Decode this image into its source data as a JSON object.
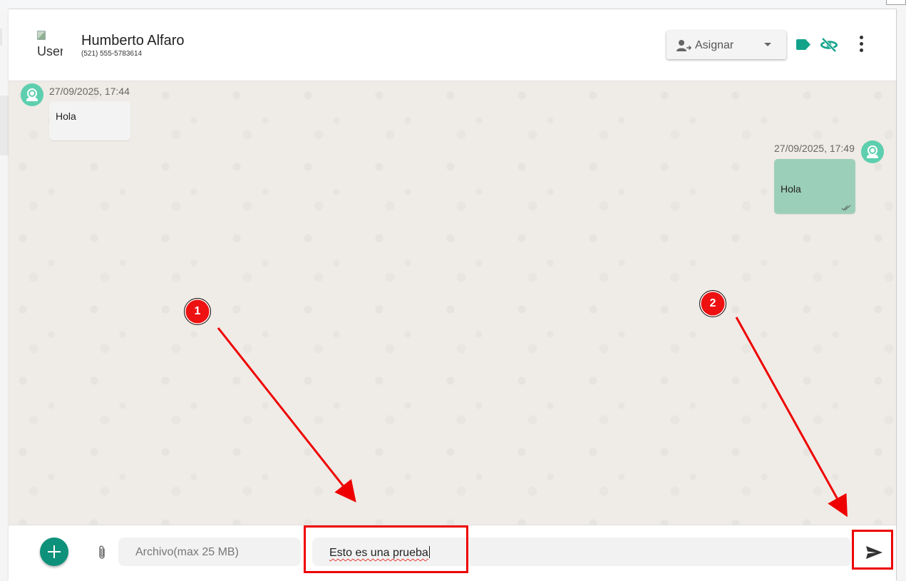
{
  "contact": {
    "avatar_alt": "User",
    "name": "Humberto Alfaro",
    "phone": "(521) 555-5783614"
  },
  "header_actions": {
    "assign_label": "Asignar",
    "icons": [
      "person-assign-icon",
      "chevron-down-icon",
      "tag-icon",
      "eye-off-icon",
      "more-vert-icon"
    ]
  },
  "messages": [
    {
      "direction": "incoming",
      "timestamp": "27/09/2025, 17:44",
      "text": "Hola"
    },
    {
      "direction": "outgoing",
      "timestamp": "27/09/2025, 17:49",
      "text": "Hola",
      "status_icon": "double-check-icon"
    }
  ],
  "composer": {
    "file_placeholder": "Archivo(max 25 MB)",
    "message_value": "Esto es una prueba",
    "icons": [
      "add-icon",
      "paperclip-icon",
      "send-icon"
    ]
  },
  "annotations": {
    "steps": [
      "1",
      "2"
    ],
    "color": "#ee0000"
  },
  "colors": {
    "accent": "#0e917a",
    "avatar": "#5dcfae",
    "outgoing_bubble": "#9ccfb9",
    "chat_background": "#efebe6"
  }
}
